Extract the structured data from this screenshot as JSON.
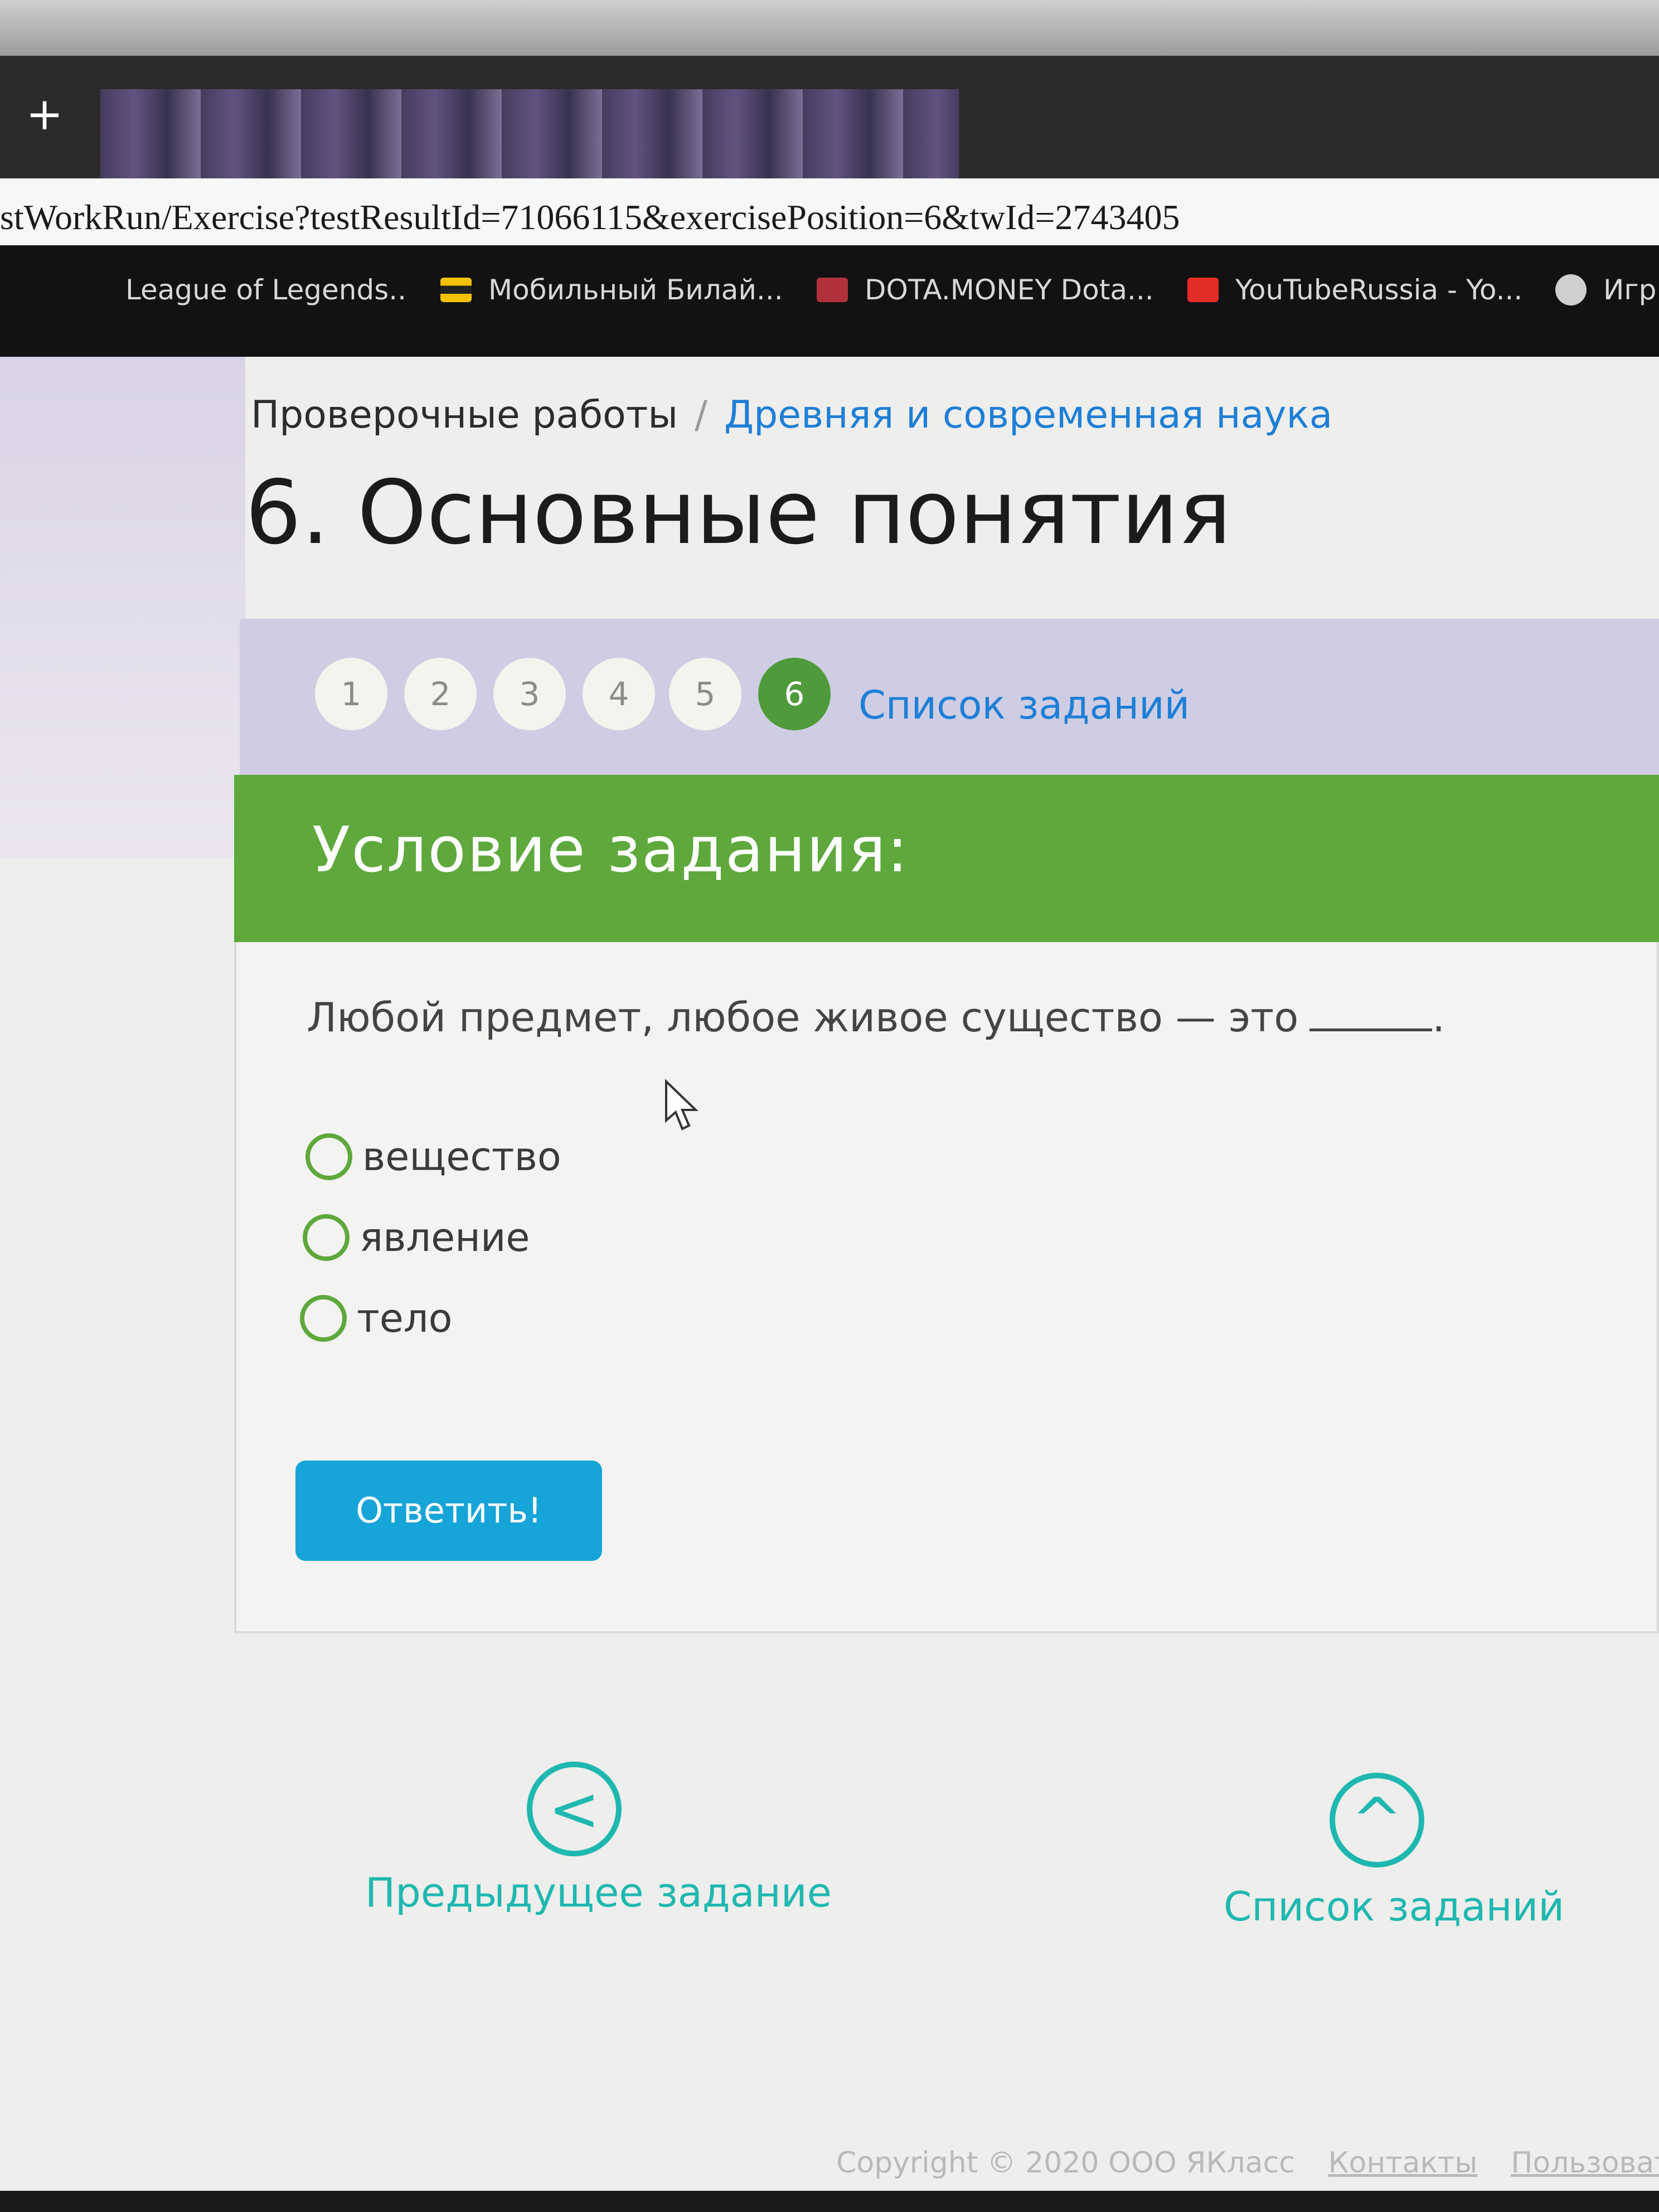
{
  "browser": {
    "new_tab": "+",
    "url": "stWorkRun/Exercise?testResultId=71066115&exercisePosition=6&twId=2743405",
    "bookmarks": [
      {
        "label": "League of Legends..",
        "icon": "lol-icon"
      },
      {
        "label": "Мобильный Билай...",
        "icon": "beeline-icon"
      },
      {
        "label": "DOTA.MONEY Dota...",
        "icon": "dota-money-icon"
      },
      {
        "label": "YouTubeRussia - Yo...",
        "icon": "youtube-icon"
      },
      {
        "label": "Игр",
        "icon": "globe-icon"
      }
    ]
  },
  "breadcrumb": {
    "parent": "Проверочные работы",
    "separator": "/",
    "current": "Древняя и современная наука"
  },
  "title": "6. Основные понятия",
  "task_nav": {
    "numbers": [
      "1",
      "2",
      "3",
      "4",
      "5",
      "6"
    ],
    "active": "6",
    "list_link": "Список заданий"
  },
  "task": {
    "header": "Условие задания:",
    "question": "Любой предмет, любое живое существо — это",
    "question_end": ".",
    "options": [
      "вещество",
      "явление",
      "тело"
    ],
    "submit": "Ответить!"
  },
  "bottom_nav": {
    "prev_label": "Предыдущее задание",
    "prev_icon": "<",
    "list_label": "Список заданий",
    "list_icon": "^"
  },
  "footer": {
    "copyright": "Copyright © 2020 ООО ЯКласс",
    "contacts": "Контакты",
    "users": "Пользователь"
  },
  "colors": {
    "accent_green": "#5ea83c",
    "link_blue": "#1e7fd6",
    "button_blue": "#17a4d8",
    "teal": "#1fb8b0"
  }
}
